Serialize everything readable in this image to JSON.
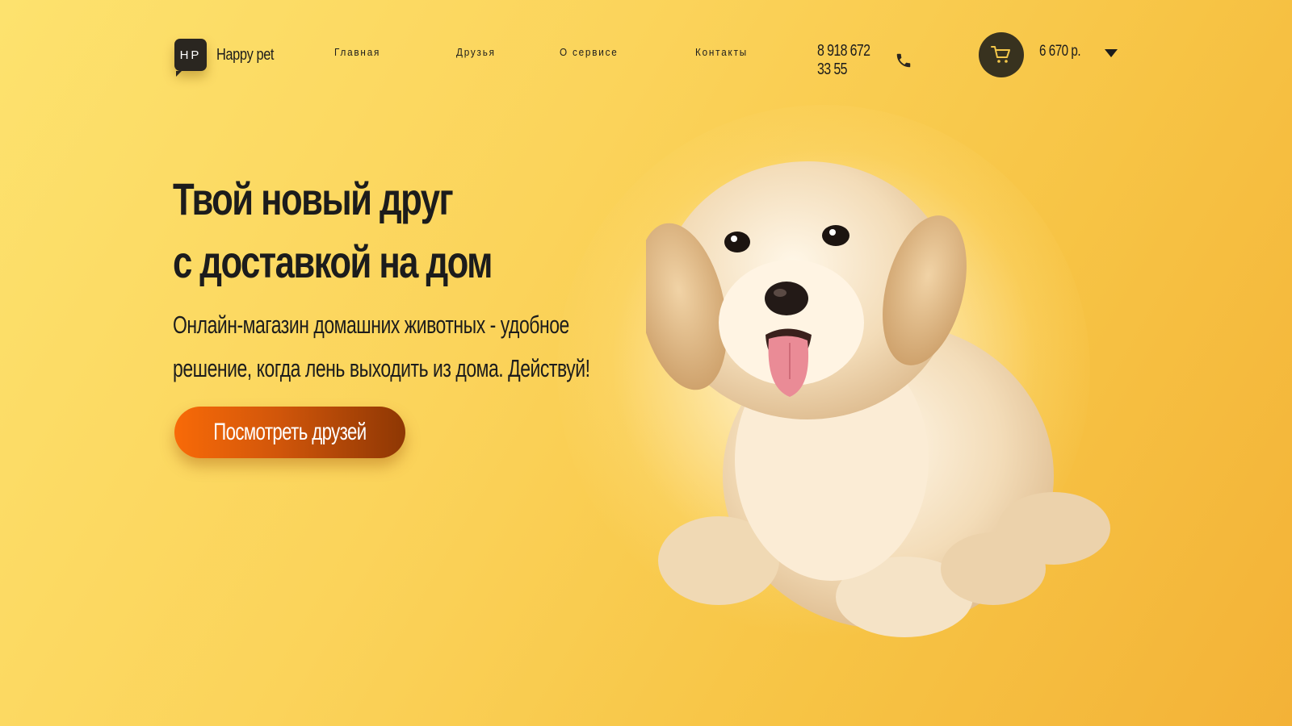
{
  "brand": {
    "mark": "HP",
    "name": "Happy pet"
  },
  "nav": {
    "items": [
      {
        "label": "Главная"
      },
      {
        "label": "Друзья"
      },
      {
        "label": "О сервисе"
      },
      {
        "label": "Контакты"
      }
    ]
  },
  "contact": {
    "phone": "8 918 672 33 55",
    "icon": "phone-icon"
  },
  "cart": {
    "total": "6 670 р.",
    "icon": "cart-icon",
    "dropdown_icon": "caret-down-icon"
  },
  "hero": {
    "title_line1": "Твой новый друг",
    "title_line2": "с доставкой на дом",
    "subtitle_line1": "Онлайн-магазин домашних животных - удобное",
    "subtitle_line2": "решение, когда лень выходить из дома. Действуй!",
    "cta_label": "Посмотреть друзей",
    "image": "puppy-illustration"
  },
  "colors": {
    "background": "#fbd35a",
    "dark": "#2a2620",
    "cta_start": "#f86a08",
    "cta_end": "#8e3704"
  }
}
